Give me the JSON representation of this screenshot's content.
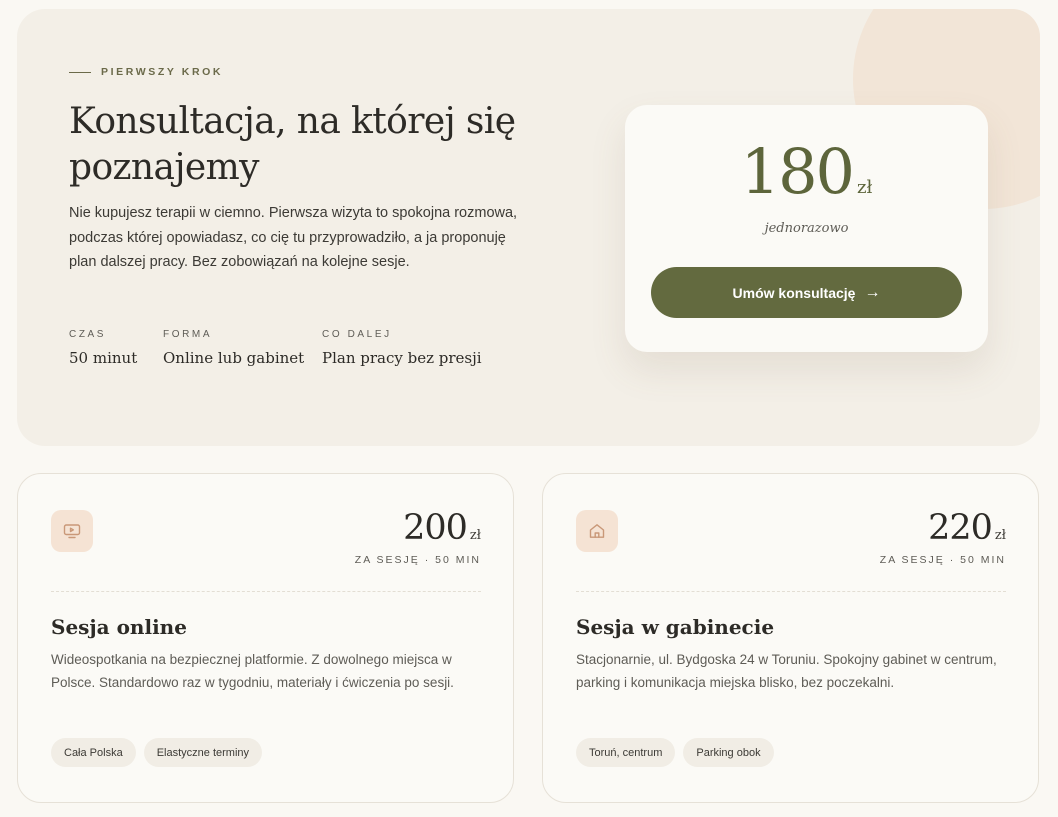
{
  "hero": {
    "eyebrow": "PIERWSZY KROK",
    "title": "Konsultacja, na której się poznajemy",
    "description": "Nie kupujesz terapii w ciemno. Pierwsza wizyta to spokojna rozmowa, podczas której opowiadasz, co cię tu przyprowadziło, a ja proponuję plan dalszej pracy. Bez zobowiązań na kolejne sesje.",
    "meta": [
      {
        "label": "CZAS",
        "value": "50 minut"
      },
      {
        "label": "FORMA",
        "value": "Online lub gabinet"
      },
      {
        "label": "CO DALEJ",
        "value": "Plan pracy bez presji"
      }
    ],
    "price_card": {
      "amount": "180",
      "currency": "zł",
      "note": "jednorazowo",
      "cta_label": "Umów konsultację",
      "cta_arrow": "→"
    }
  },
  "cards": [
    {
      "icon": "monitor-icon",
      "amount": "200",
      "currency": "zł",
      "price_note": "ZA SESJĘ · 50 MIN",
      "title": "Sesja online",
      "description": "Wideospotkania na bezpiecznej platformie. Z dowolnego miejsca w Polsce. Standardowo raz w tygodniu, materiały i ćwiczenia po sesji.",
      "tags": [
        "Cała Polska",
        "Elastyczne terminy"
      ]
    },
    {
      "icon": "home-icon",
      "amount": "220",
      "currency": "zł",
      "price_note": "ZA SESJĘ · 50 MIN",
      "title": "Sesja w gabinecie",
      "description": "Stacjonarnie, ul. Bydgoska 24 w Toruniu. Spokojny gabinet w centrum, parking i komunikacja miejska blisko, bez poczekalni.",
      "tags": [
        "Toruń, centrum",
        "Parking obok"
      ]
    }
  ],
  "colors": {
    "accent": "#636a3f",
    "icon_bg": "#f5e3d4",
    "icon_stroke": "#c99878",
    "hero_bg": "#f3efe7"
  }
}
